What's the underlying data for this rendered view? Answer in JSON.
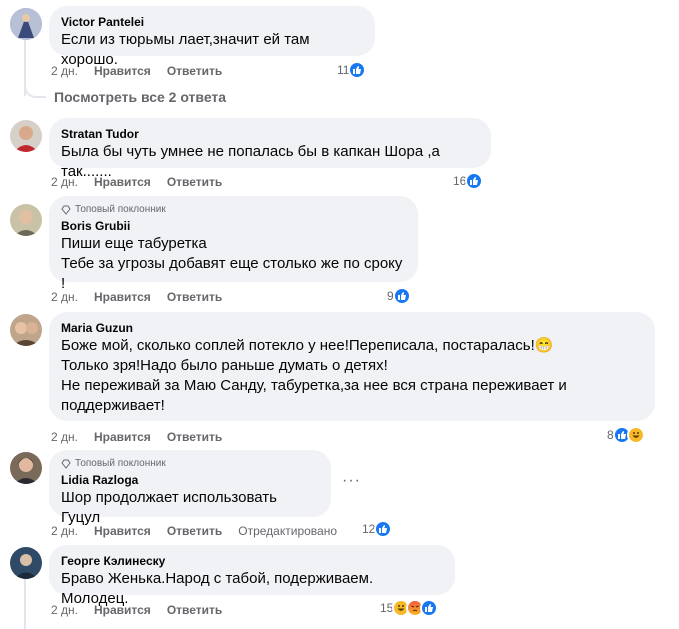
{
  "view_replies": "Посмотреть все 2 ответа",
  "comments": [
    {
      "author": "Victor Pantelei",
      "fan_badge": "",
      "text": "Если из тюрьмы лает,значит ей там хорошо.",
      "time": "2 дн.",
      "like": "Нравится",
      "reply": "Ответить",
      "edited": "",
      "count": "11",
      "reactions": [
        "like"
      ]
    },
    {
      "author": "Stratan Tudor",
      "fan_badge": "",
      "text": "Была бы чуть умнее не попалась бы в капкан Шора ,а так.......",
      "time": "2 дн.",
      "like": "Нравится",
      "reply": "Ответить",
      "edited": "",
      "count": "16",
      "reactions": [
        "like"
      ]
    },
    {
      "author": "Boris Grubii",
      "fan_badge": "Топовый поклонник",
      "text": "Пиши еще табуретка\nТебе за угрозы добавят еще столько же по сроку !",
      "time": "2 дн.",
      "like": "Нравится",
      "reply": "Ответить",
      "edited": "",
      "count": "9",
      "reactions": [
        "like"
      ]
    },
    {
      "author": "Maria Guzun",
      "fan_badge": "",
      "text": "Боже мой, сколько соплей потекло у нее!Переписала, постаралась!😁\nТолько зря!Надо было раньше думать о детях!\nНе переживай за Маю Санду, табуретка,за нее вся страна переживает и\nподдерживает!",
      "time": "2 дн.",
      "like": "Нравится",
      "reply": "Ответить",
      "edited": "",
      "count": "8",
      "reactions": [
        "like",
        "haha"
      ]
    },
    {
      "author": "Lidia Razloga",
      "fan_badge": "Топовый поклонник",
      "text": "Шор продолжает использовать Гуцул",
      "time": "2 дн.",
      "like": "Нравится",
      "reply": "Ответить",
      "edited": "Отредактировано",
      "count": "12",
      "reactions": [
        "like"
      ]
    },
    {
      "author": "Георге Кэлинеску",
      "fan_badge": "",
      "text": "Браво Женька.Народ с табой, подерживаем. Молодец.",
      "time": "2 дн.",
      "like": "Нравится",
      "reply": "Ответить",
      "edited": "",
      "count": "15",
      "reactions": [
        "haha",
        "angry",
        "like"
      ]
    }
  ],
  "more_options": "···",
  "colors": {
    "bubble": "#f0f2f5",
    "meta": "#65676b",
    "like_blue": "#1877f2",
    "haha_yellow": "#f7b928"
  }
}
